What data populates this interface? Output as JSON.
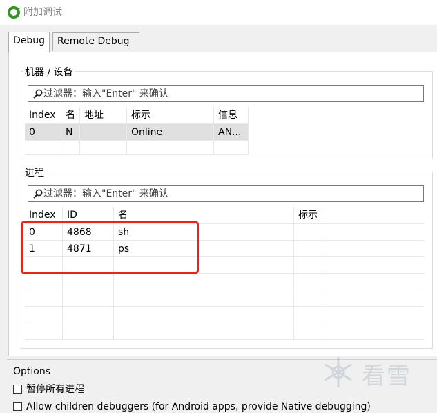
{
  "window": {
    "title": "附加调试",
    "app_icon": "refresh-ring-icon"
  },
  "tabs": [
    {
      "label": "Debug"
    },
    {
      "label": "Remote Debug"
    }
  ],
  "machines": {
    "group_label": "机器 / 设备",
    "filter_placeholder": "过滤器：输入\"Enter\" 来确认",
    "columns": [
      "Index",
      "名",
      "地址",
      "标示",
      "信息"
    ],
    "rows": [
      [
        "0",
        "N",
        "",
        "Online",
        "AN..."
      ]
    ]
  },
  "processes": {
    "group_label": "进程",
    "filter_placeholder": "过滤器：输入\"Enter\" 来确认",
    "columns": [
      "Index",
      "ID",
      "名",
      "标示"
    ],
    "rows": [
      [
        "0",
        "4868",
        "sh",
        ""
      ],
      [
        "1",
        "4871",
        "ps",
        ""
      ]
    ]
  },
  "options": {
    "label": "Options",
    "checkboxes": [
      {
        "label": "暂停所有进程",
        "checked": false
      },
      {
        "label": "Allow children debuggers (for Android apps, provide Native debugging)",
        "checked": false
      }
    ]
  },
  "watermark": {
    "text": "看雪"
  },
  "colors": {
    "highlight_box": "#e8231e",
    "selected_row": "#e0e0e0"
  }
}
